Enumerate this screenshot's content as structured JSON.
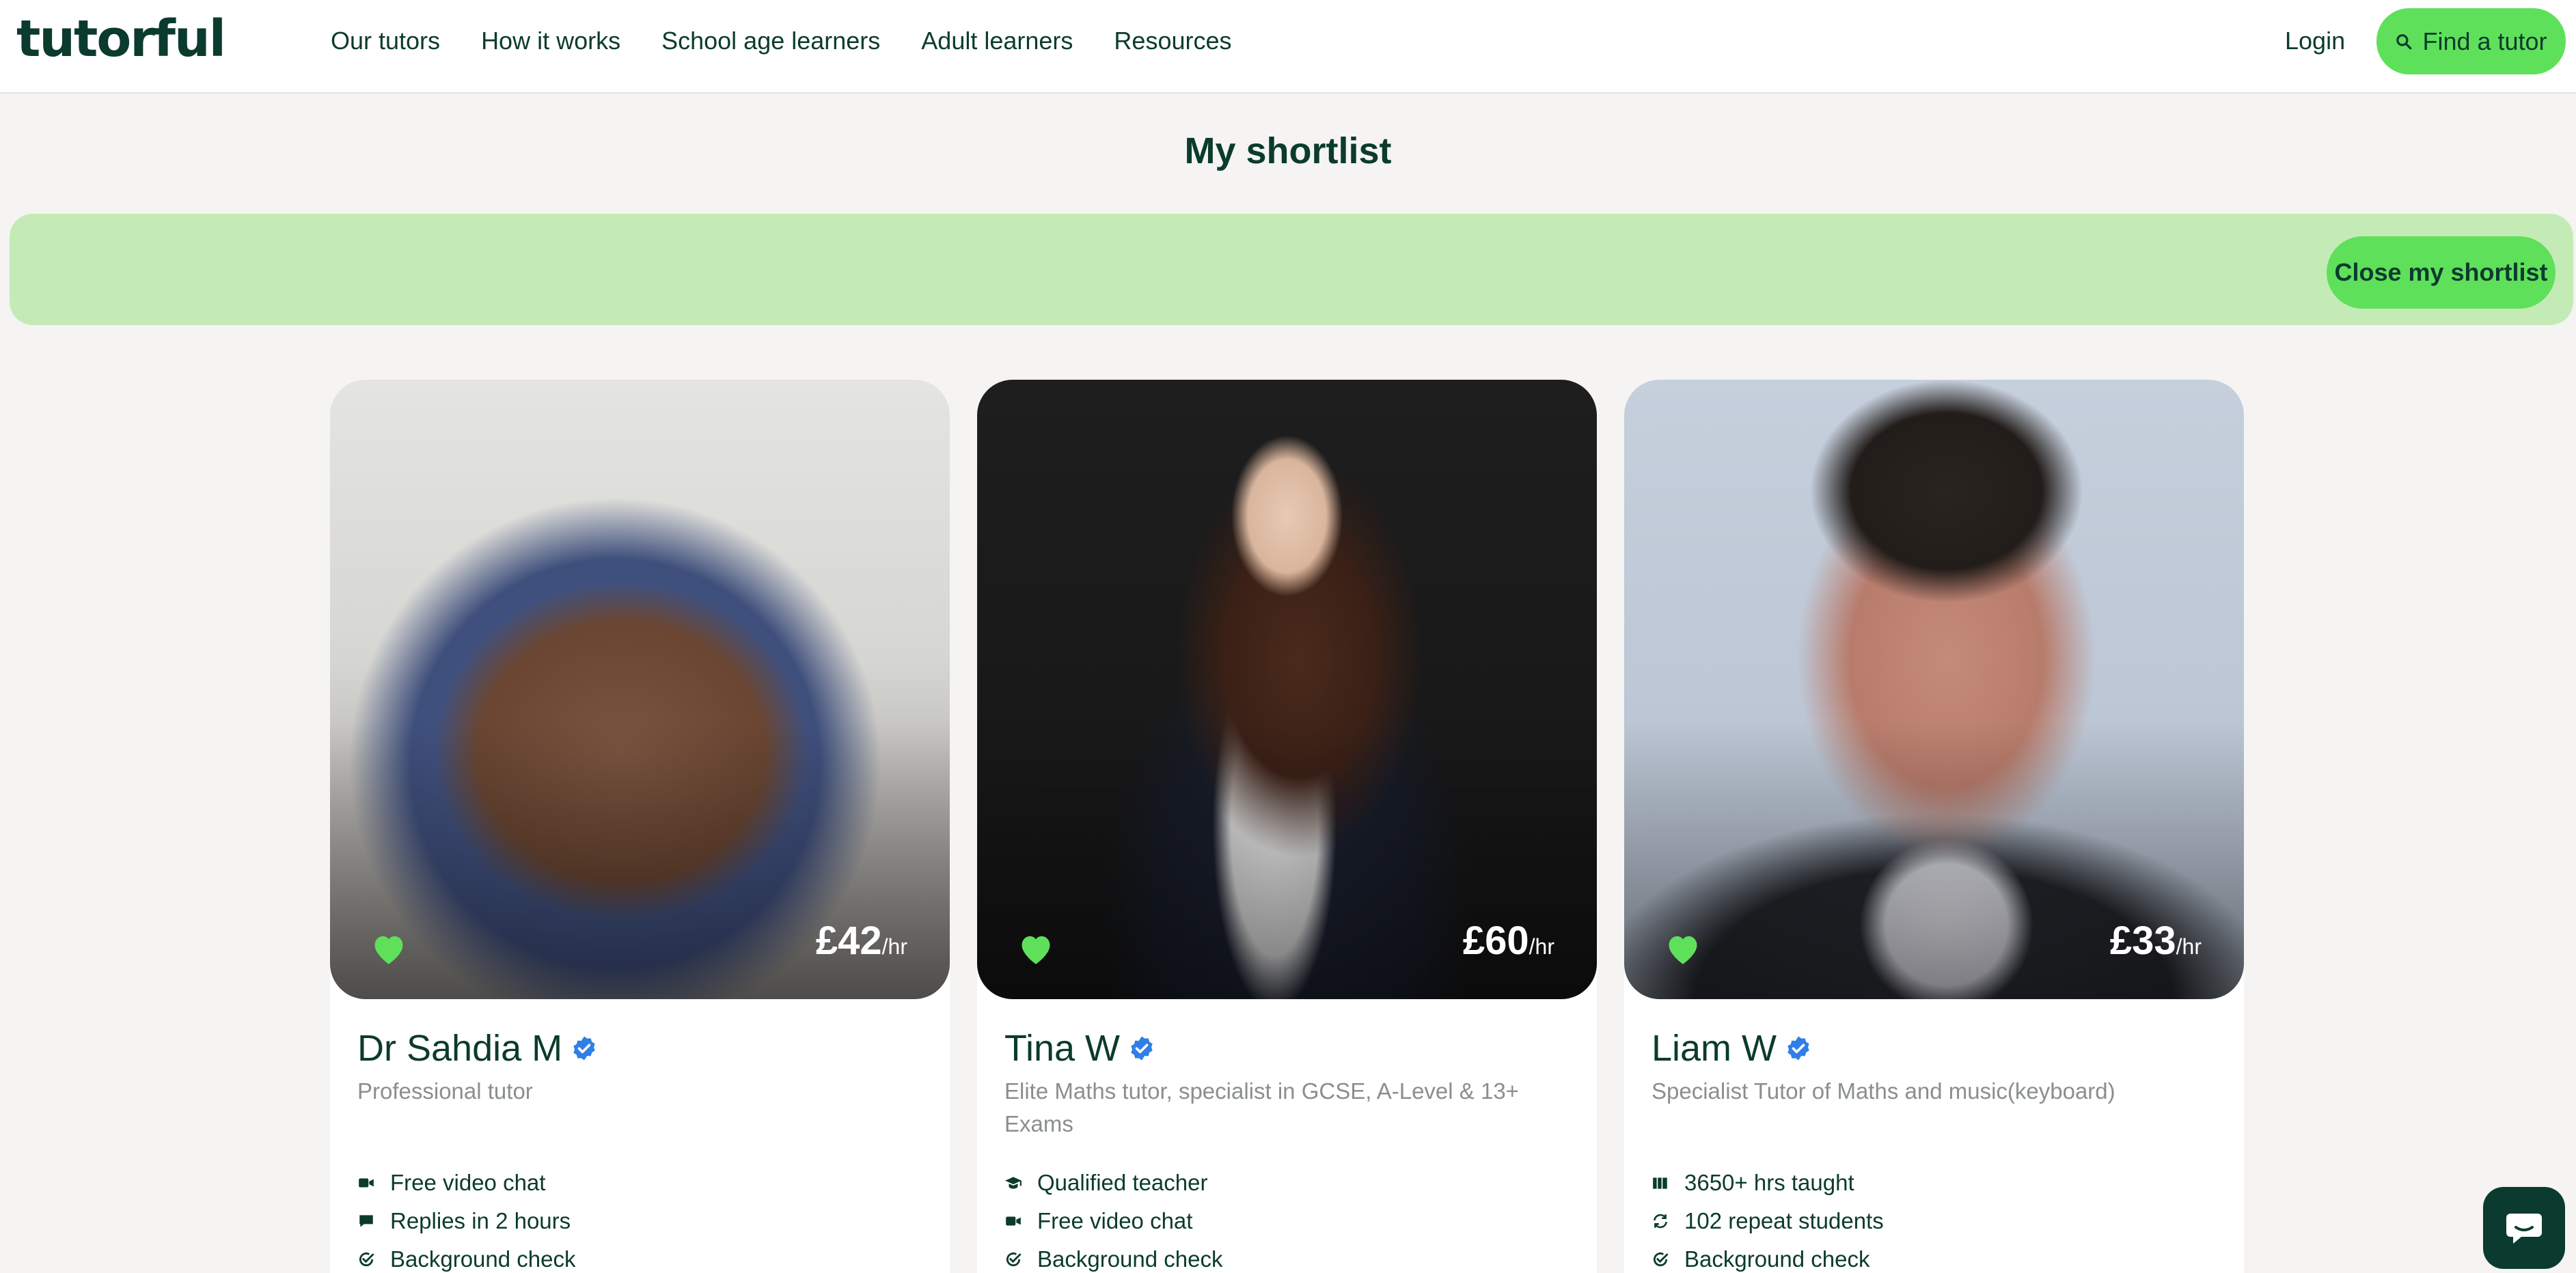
{
  "header": {
    "logo": "tutorful",
    "nav": [
      "Our tutors",
      "How it works",
      "School age learners",
      "Adult learners",
      "Resources"
    ],
    "login_label": "Login",
    "find_label": "Find a tutor"
  },
  "page": {
    "title": "My shortlist",
    "close_label": "Close my shortlist"
  },
  "tutors": [
    {
      "name": "Dr Sahdia M",
      "subtitle": "Professional tutor",
      "price": "£42",
      "unit": "/hr",
      "features": [
        {
          "icon": "video-icon",
          "label": "Free video chat"
        },
        {
          "icon": "chat-icon",
          "label": "Replies in 2 hours"
        },
        {
          "icon": "check-icon",
          "label": "Background check"
        }
      ]
    },
    {
      "name": "Tina W",
      "subtitle": "Elite Maths tutor, specialist in GCSE, A-Level & 13+ Exams",
      "price": "£60",
      "unit": "/hr",
      "features": [
        {
          "icon": "graduation-cap-icon",
          "label": "Qualified teacher"
        },
        {
          "icon": "video-icon",
          "label": "Free video chat"
        },
        {
          "icon": "check-icon",
          "label": "Background check"
        }
      ]
    },
    {
      "name": "Liam W",
      "subtitle": "Specialist Tutor of Maths and music(keyboard)",
      "price": "£33",
      "unit": "/hr",
      "features": [
        {
          "icon": "books-icon",
          "label": "3650+ hrs taught"
        },
        {
          "icon": "repeat-icon",
          "label": "102 repeat students"
        },
        {
          "icon": "check-icon",
          "label": "Background check"
        }
      ]
    }
  ],
  "colors": {
    "brand": "#0b3b2e",
    "accent": "#5fe05a",
    "banner": "#c4ebb6",
    "verified": "#2f7fe6"
  }
}
